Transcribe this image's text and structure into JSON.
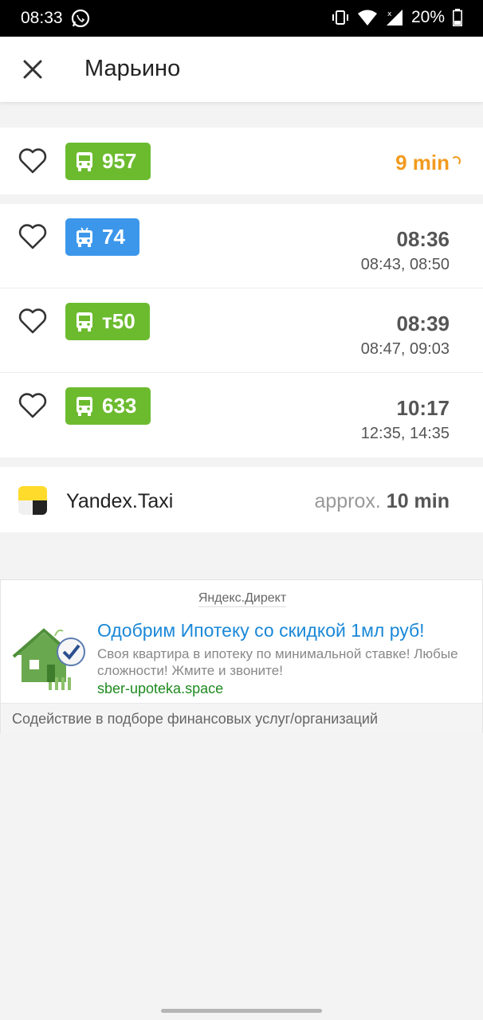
{
  "status_bar": {
    "time": "08:33",
    "battery": "20%",
    "icons": [
      "whatsapp-icon",
      "vibrate-icon",
      "wifi-icon",
      "signal-icon",
      "battery-icon"
    ]
  },
  "header": {
    "title": "Марьино",
    "close_icon": "close-icon"
  },
  "routes_live": [
    {
      "number": "957",
      "type": "bus",
      "color": "#6cbb2f",
      "eta": "9 min"
    }
  ],
  "routes_schedule": [
    {
      "number": "74",
      "type": "trolleybus",
      "color": "#3c97eb",
      "time": "08:36",
      "next": "08:43, 08:50"
    },
    {
      "number": "т50",
      "type": "bus",
      "color": "#6cbb2f",
      "time": "08:39",
      "next": "08:47, 09:03"
    },
    {
      "number": "633",
      "type": "bus",
      "color": "#6cbb2f",
      "time": "10:17",
      "next": "12:35, 14:35"
    }
  ],
  "taxi": {
    "name": "Yandex.Taxi",
    "approx_label": "approx.",
    "eta": "10 min"
  },
  "ad": {
    "source": "Яндекс.Директ",
    "headline": "Одобрим Ипотеку со скидкой 1мл руб!",
    "description": "Своя квартира в ипотеку по минимальной ставке! Любые сложности! Жмите и звоните!",
    "url": "sber-upoteka.space",
    "footer": "Содействие в подборе финансовых услуг/организаций"
  },
  "colors": {
    "accent_orange": "#f29a1e",
    "bus_green": "#6cbb2f",
    "trolley_blue": "#3c97eb",
    "ad_link": "#1a88d8"
  }
}
